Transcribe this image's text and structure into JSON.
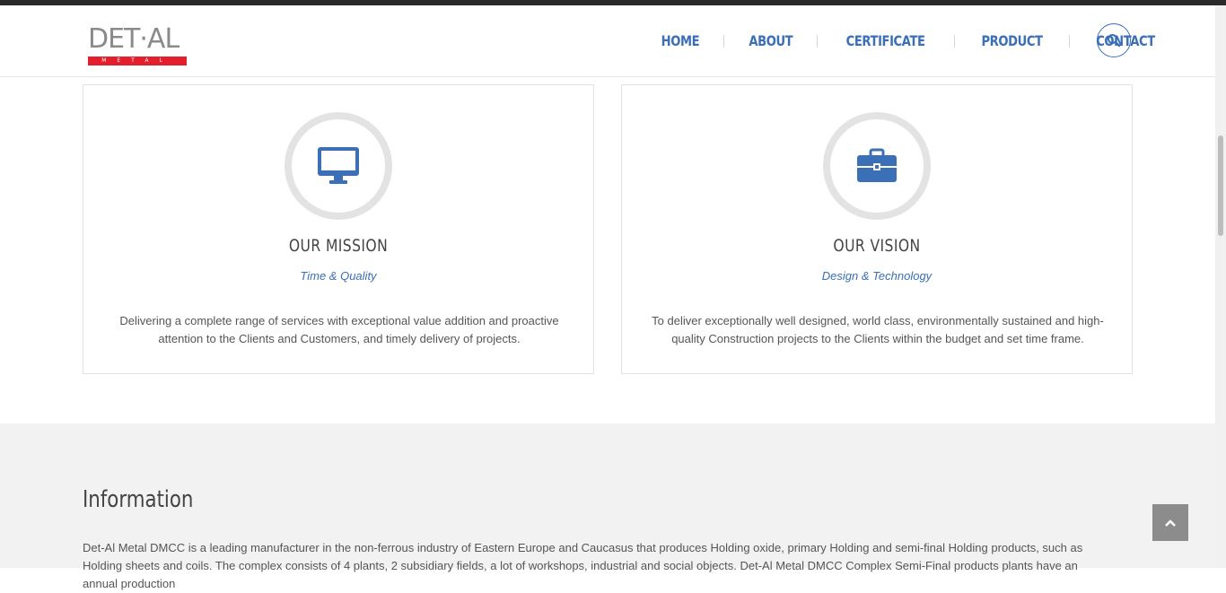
{
  "header": {
    "logo_text": "DET·AL",
    "logo_sub": "METAL",
    "nav": [
      "HOME",
      "ABOUT",
      "CERTIFICATE",
      "PRODUCT",
      "CONTACT"
    ]
  },
  "mission": {
    "icon": "desktop-monitor-icon",
    "title": "OUR MISSION",
    "subtitle": "Time & Quality",
    "text": "Delivering a complete range of services with exceptional value addition and proactive attention to the Clients and Customers, and timely delivery of projects."
  },
  "vision": {
    "icon": "briefcase-icon",
    "title": "OUR VISION",
    "subtitle": "Design & Technology",
    "text": "To deliver exceptionally well designed, world class, environmentally sustained and high-quality Construction projects to the Clients within the budget and set time frame."
  },
  "information": {
    "title": "Information",
    "text": "Det-Al Metal DMCC is a leading manufacturer in the non-ferrous industry of Eastern Europe and Caucasus that produces Holding oxide, primary Holding and semi-final Holding products, such as Holding sheets and coils. The complex consists of 4 plants, 2 subsidiary fields, a lot of workshops, industrial and social objects. Det-Al Metal DMCC Complex Semi-Final products plants have an annual production"
  },
  "colors": {
    "accent": "#3b6fb6",
    "logo_red": "#e31e2d",
    "section_bg": "#f2f2f2"
  }
}
